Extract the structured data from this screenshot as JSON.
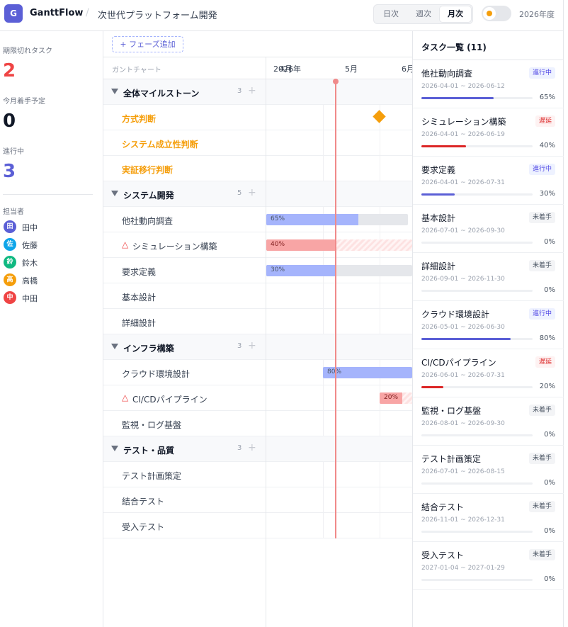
{
  "header": {
    "logo": "G",
    "app_name": "GanttFlow",
    "separator": "/",
    "project": "次世代プラットフォーム開発",
    "views": [
      "日次",
      "週次",
      "月次"
    ],
    "active_view": "月次",
    "year": "2026年度",
    "theme_toggle_icon": "sun-icon"
  },
  "stats": {
    "overdue_label": "期限切れタスク",
    "overdue_value": "2",
    "starting_label": "今月着手予定",
    "starting_value": "0",
    "inprogress_label": "進行中",
    "inprogress_value": "3",
    "assignees_label": "担当者",
    "assignees": [
      {
        "initial": "田",
        "name": "田中",
        "color": "#5b5fd6"
      },
      {
        "initial": "佐",
        "name": "佐藤",
        "color": "#0ea5e9"
      },
      {
        "initial": "鈴",
        "name": "鈴木",
        "color": "#10b981"
      },
      {
        "initial": "高",
        "name": "高橋",
        "color": "#f59e0b"
      },
      {
        "initial": "中",
        "name": "中田",
        "color": "#ef4444"
      }
    ]
  },
  "gantt": {
    "add_phase": "+ フェーズ追加",
    "header_label": "ガントチャート",
    "months": [
      "2026年",
      "4月",
      "5月",
      "6月"
    ],
    "phases": [
      {
        "name": "全体マイルストーン",
        "count": "3",
        "plus": "+",
        "rows": [
          {
            "name": "方式判断",
            "type": "milestone"
          },
          {
            "name": "システム成立性判断",
            "type": "milestone"
          },
          {
            "name": "実証移行判断",
            "type": "milestone"
          }
        ]
      },
      {
        "name": "システム開発",
        "count": "5",
        "plus": "+",
        "rows": [
          {
            "name": "他社動向調査",
            "type": "task",
            "bar": {
              "label": "65%",
              "progress": 0.65,
              "status": "normal"
            }
          },
          {
            "name": "シミュレーション構築",
            "type": "task",
            "warn": "△",
            "bar": {
              "label": "40%",
              "progress": 0.4,
              "status": "late"
            }
          },
          {
            "name": "要求定義",
            "type": "task",
            "bar": {
              "label": "30%",
              "progress": 0.3,
              "status": "normal"
            }
          },
          {
            "name": "基本設計",
            "type": "task"
          },
          {
            "name": "詳細設計",
            "type": "task"
          }
        ]
      },
      {
        "name": "インフラ構築",
        "count": "3",
        "plus": "+",
        "rows": [
          {
            "name": "クラウド環境設計",
            "type": "task",
            "bar": {
              "label": "80%",
              "progress": 0.8,
              "status": "normal"
            }
          },
          {
            "name": "CI/CDパイプライン",
            "type": "task",
            "warn": "△",
            "bar": {
              "label": "20%",
              "progress": 0.2,
              "status": "late"
            }
          },
          {
            "name": "監視・ログ基盤",
            "type": "task"
          }
        ]
      },
      {
        "name": "テスト・品質",
        "count": "3",
        "plus": "+",
        "rows": [
          {
            "name": "テスト計画策定",
            "type": "task"
          },
          {
            "name": "結合テスト",
            "type": "task"
          },
          {
            "name": "受入テスト",
            "type": "task"
          }
        ]
      }
    ]
  },
  "panel": {
    "title": "タスク一覧 (11)",
    "tasks": [
      {
        "name": "他社動向調査",
        "dates": "2026-04-01 ~ 2026-06-12",
        "status": "進行中",
        "status_key": "st-ip",
        "progress": "65%"
      },
      {
        "name": "シミュレーション構築",
        "dates": "2026-04-01 ~ 2026-06-19",
        "status": "遅延",
        "status_key": "st-late",
        "progress": "40%"
      },
      {
        "name": "要求定義",
        "dates": "2026-04-01 ~ 2026-07-31",
        "status": "進行中",
        "status_key": "st-ip",
        "progress": "30%"
      },
      {
        "name": "基本設計",
        "dates": "2026-07-01 ~ 2026-09-30",
        "status": "未着手",
        "status_key": "st-ns",
        "progress": "0%"
      },
      {
        "name": "詳細設計",
        "dates": "2026-09-01 ~ 2026-11-30",
        "status": "未着手",
        "status_key": "st-ns",
        "progress": "0%"
      },
      {
        "name": "クラウド環境設計",
        "dates": "2026-05-01 ~ 2026-06-30",
        "status": "進行中",
        "status_key": "st-ip",
        "progress": "80%"
      },
      {
        "name": "CI/CDパイプライン",
        "dates": "2026-06-01 ~ 2026-07-31",
        "status": "遅延",
        "status_key": "st-late",
        "progress": "20%"
      },
      {
        "name": "監視・ログ基盤",
        "dates": "2026-08-01 ~ 2026-09-30",
        "status": "未着手",
        "status_key": "st-ns",
        "progress": "0%"
      },
      {
        "name": "テスト計画策定",
        "dates": "2026-07-01 ~ 2026-08-15",
        "status": "未着手",
        "status_key": "st-ns",
        "progress": "0%"
      },
      {
        "name": "結合テスト",
        "dates": "2026-11-01 ~ 2026-12-31",
        "status": "未着手",
        "status_key": "st-ns",
        "progress": "0%"
      },
      {
        "name": "受入テスト",
        "dates": "2027-01-04 ~ 2027-01-29",
        "status": "未着手",
        "status_key": "st-ns",
        "progress": "0%"
      }
    ]
  }
}
